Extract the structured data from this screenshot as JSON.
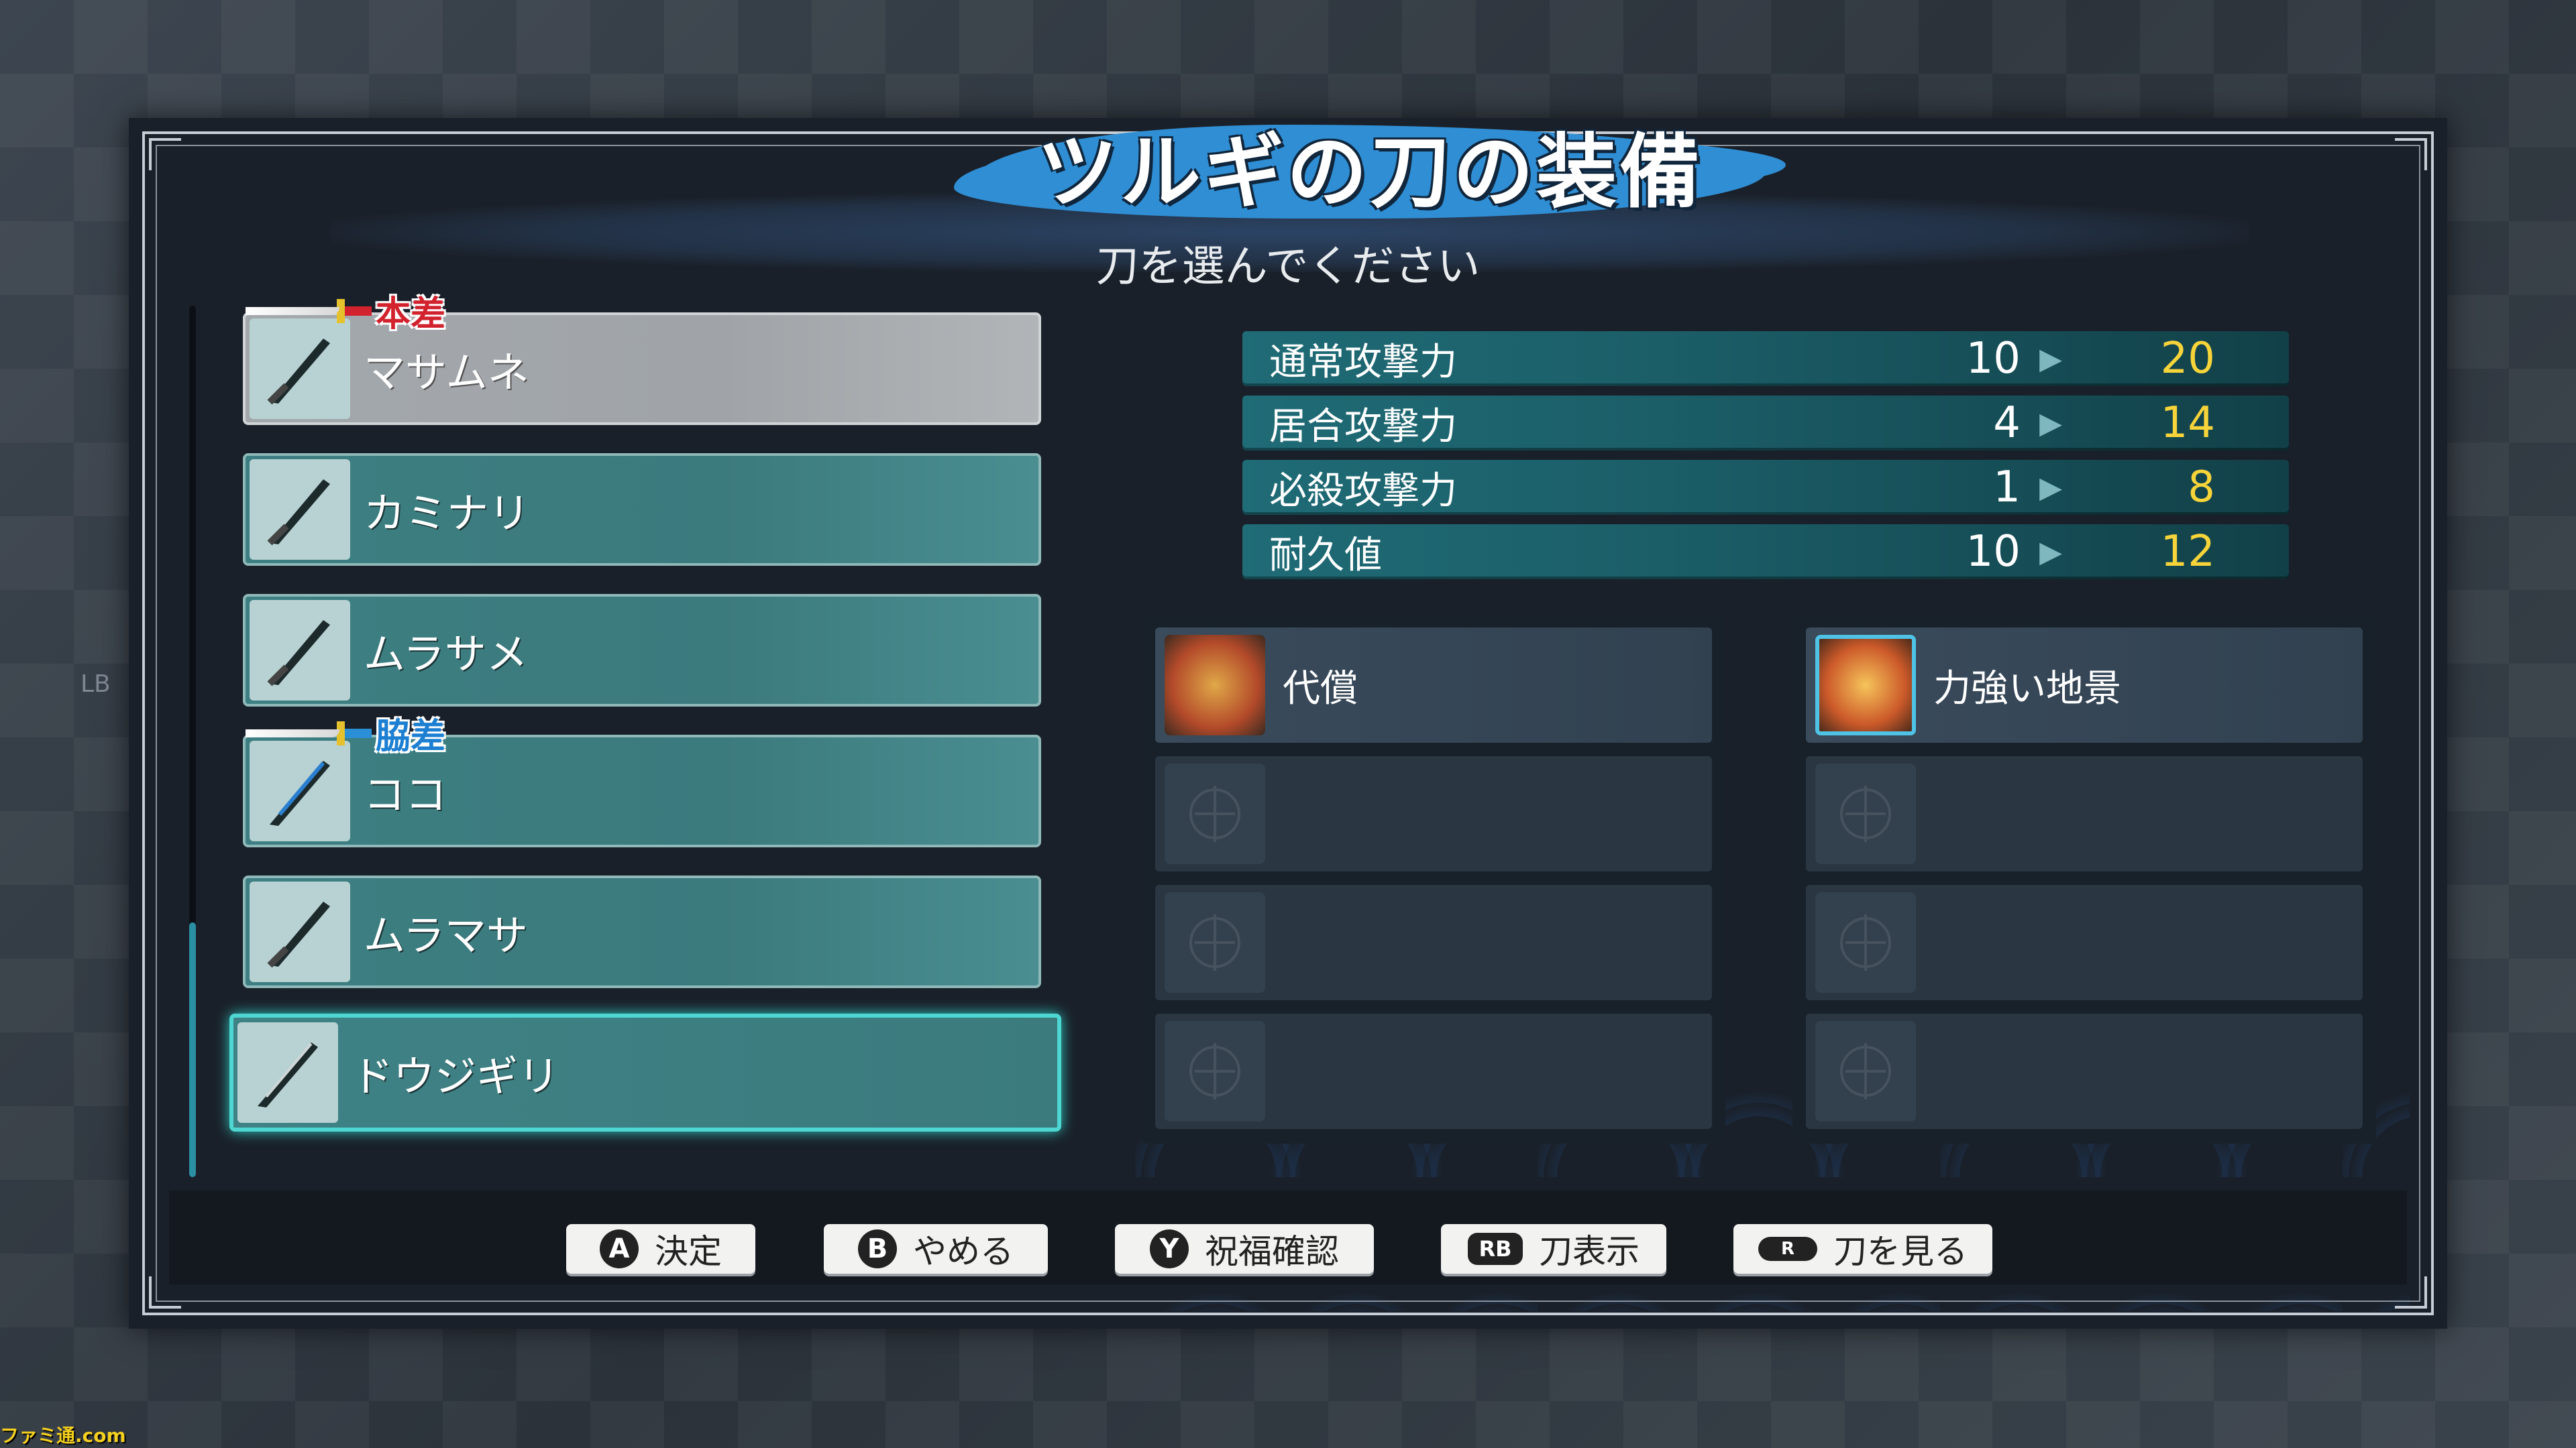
{
  "screen": {
    "title": "ツルギの刀の装備",
    "subtitle": "刀を選んでください",
    "lb_hint": "LB"
  },
  "swords": [
    {
      "label": "マサムネ",
      "tag": "本差",
      "tag_color": "red",
      "state": "dimmed"
    },
    {
      "label": "カミナリ",
      "tag": "",
      "tag_color": "",
      "state": "normal"
    },
    {
      "label": "ムラサメ",
      "tag": "",
      "tag_color": "",
      "state": "normal"
    },
    {
      "label": "ココ",
      "tag": "脇差",
      "tag_color": "blue",
      "state": "normal"
    },
    {
      "label": "ムラマサ",
      "tag": "",
      "tag_color": "",
      "state": "normal"
    },
    {
      "label": "ドウジギリ",
      "tag": "",
      "tag_color": "",
      "state": "selected"
    }
  ],
  "stats": [
    {
      "name": "通常攻撃力",
      "current": "10",
      "new": "20"
    },
    {
      "name": "居合攻撃力",
      "current": "4",
      "new": "14"
    },
    {
      "name": "必殺攻撃力",
      "current": "1",
      "new": "8"
    },
    {
      "name": "耐久値",
      "current": "10",
      "new": "12"
    }
  ],
  "stat_arrow": "▶",
  "skills_current": [
    {
      "label": "代償",
      "icon": "blessing-art-icon"
    },
    {
      "label": "",
      "icon": "empty-slot-icon"
    },
    {
      "label": "",
      "icon": "empty-slot-icon"
    },
    {
      "label": "",
      "icon": "empty-slot-icon"
    }
  ],
  "skills_new": [
    {
      "label": "力強い地景",
      "icon": "blessing-art-icon"
    },
    {
      "label": "",
      "icon": "empty-slot-icon"
    },
    {
      "label": "",
      "icon": "empty-slot-icon"
    },
    {
      "label": "",
      "icon": "empty-slot-icon"
    }
  ],
  "compare_arrow": "▶",
  "buttons": [
    {
      "glyph": "A",
      "label": "決定"
    },
    {
      "glyph": "B",
      "label": "やめる"
    },
    {
      "glyph": "Y",
      "label": "祝福確認"
    },
    {
      "glyph": "RB",
      "label": "刀表示"
    },
    {
      "glyph": "R",
      "label": "刀を見る"
    }
  ],
  "watermark": "ファミ通.com",
  "colors": {
    "accent_selected": "#4ed7d2",
    "stat_new": "#f7d43a",
    "tag_red": "#d1222e",
    "tag_blue": "#1c7fd1"
  }
}
